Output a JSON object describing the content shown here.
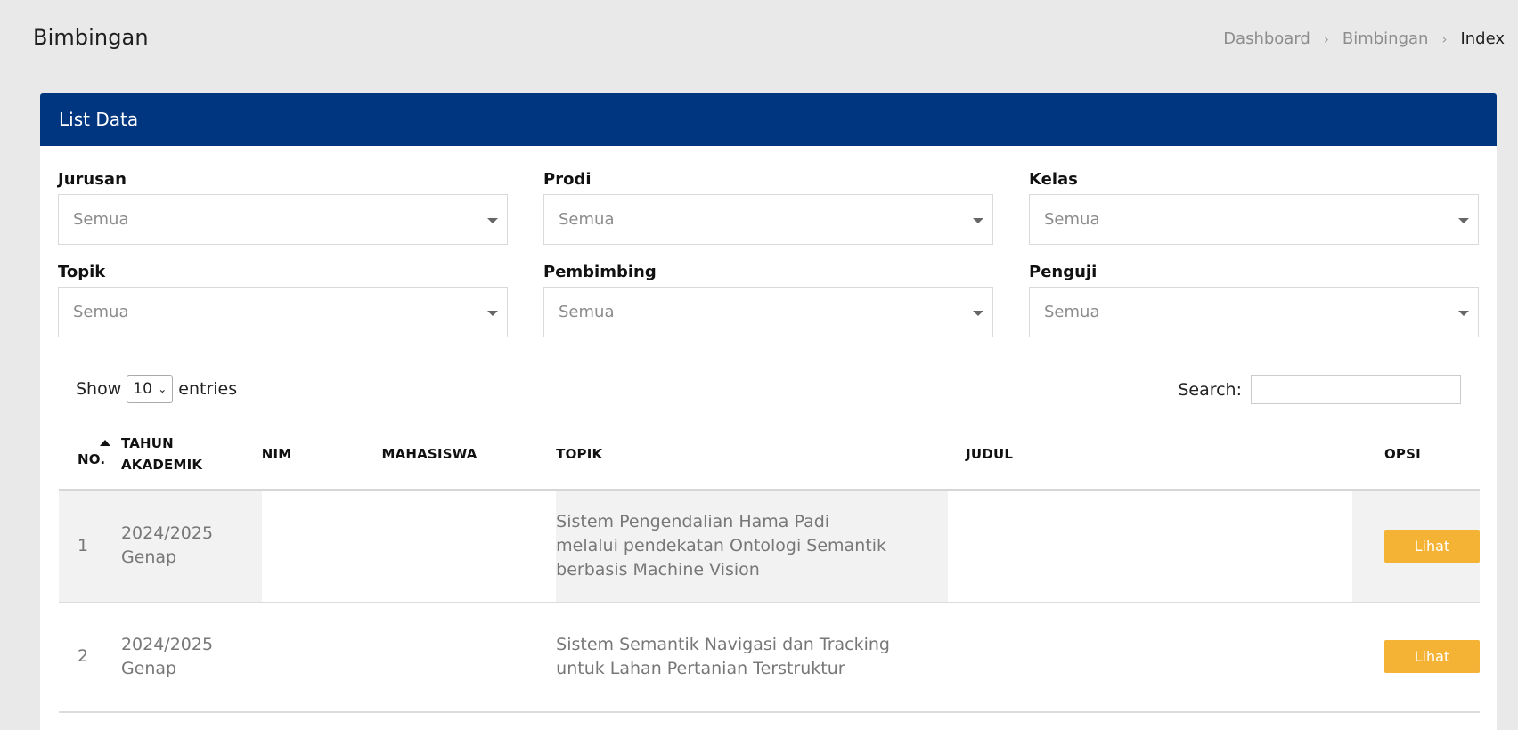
{
  "page": {
    "title": "Bimbingan",
    "breadcrumb": [
      "Dashboard",
      "Bimbingan",
      "Index"
    ]
  },
  "card": {
    "title": "List Data"
  },
  "filters": [
    {
      "label": "Jurusan",
      "value": "Semua"
    },
    {
      "label": "Prodi",
      "value": "Semua"
    },
    {
      "label": "Kelas",
      "value": "Semua"
    },
    {
      "label": "Topik",
      "value": "Semua"
    },
    {
      "label": "Pembimbing",
      "value": "Semua"
    },
    {
      "label": "Penguji",
      "value": "Semua"
    }
  ],
  "table_controls": {
    "show_label": "Show",
    "entries_value": "10",
    "entries_label": "entries",
    "search_label": "Search:",
    "search_value": ""
  },
  "table": {
    "headers": {
      "no": "NO.",
      "tahun_1": "TAHUN",
      "tahun_2": "AKADEMIK",
      "nim": "NIM",
      "mahasiswa": "MAHASISWA",
      "topik": "TOPIK",
      "judul": "JUDUL",
      "opsi": "OPSI"
    },
    "rows": [
      {
        "no": "1",
        "tahun_1": "2024/2025",
        "tahun_2": "Genap",
        "nim": "",
        "mahasiswa": "",
        "topik_1": "Sistem Pengendalian Hama Padi",
        "topik_2": "melalui pendekatan Ontologi Semantik",
        "topik_3": "berbasis Machine Vision",
        "judul": "",
        "action": "Lihat"
      },
      {
        "no": "2",
        "tahun_1": "2024/2025",
        "tahun_2": "Genap",
        "nim": "",
        "mahasiswa": "",
        "topik_1": "Sistem Semantik Navigasi dan Tracking",
        "topik_2": "untuk Lahan Pertanian Terstruktur",
        "judul": "",
        "action": "Lihat"
      }
    ]
  }
}
